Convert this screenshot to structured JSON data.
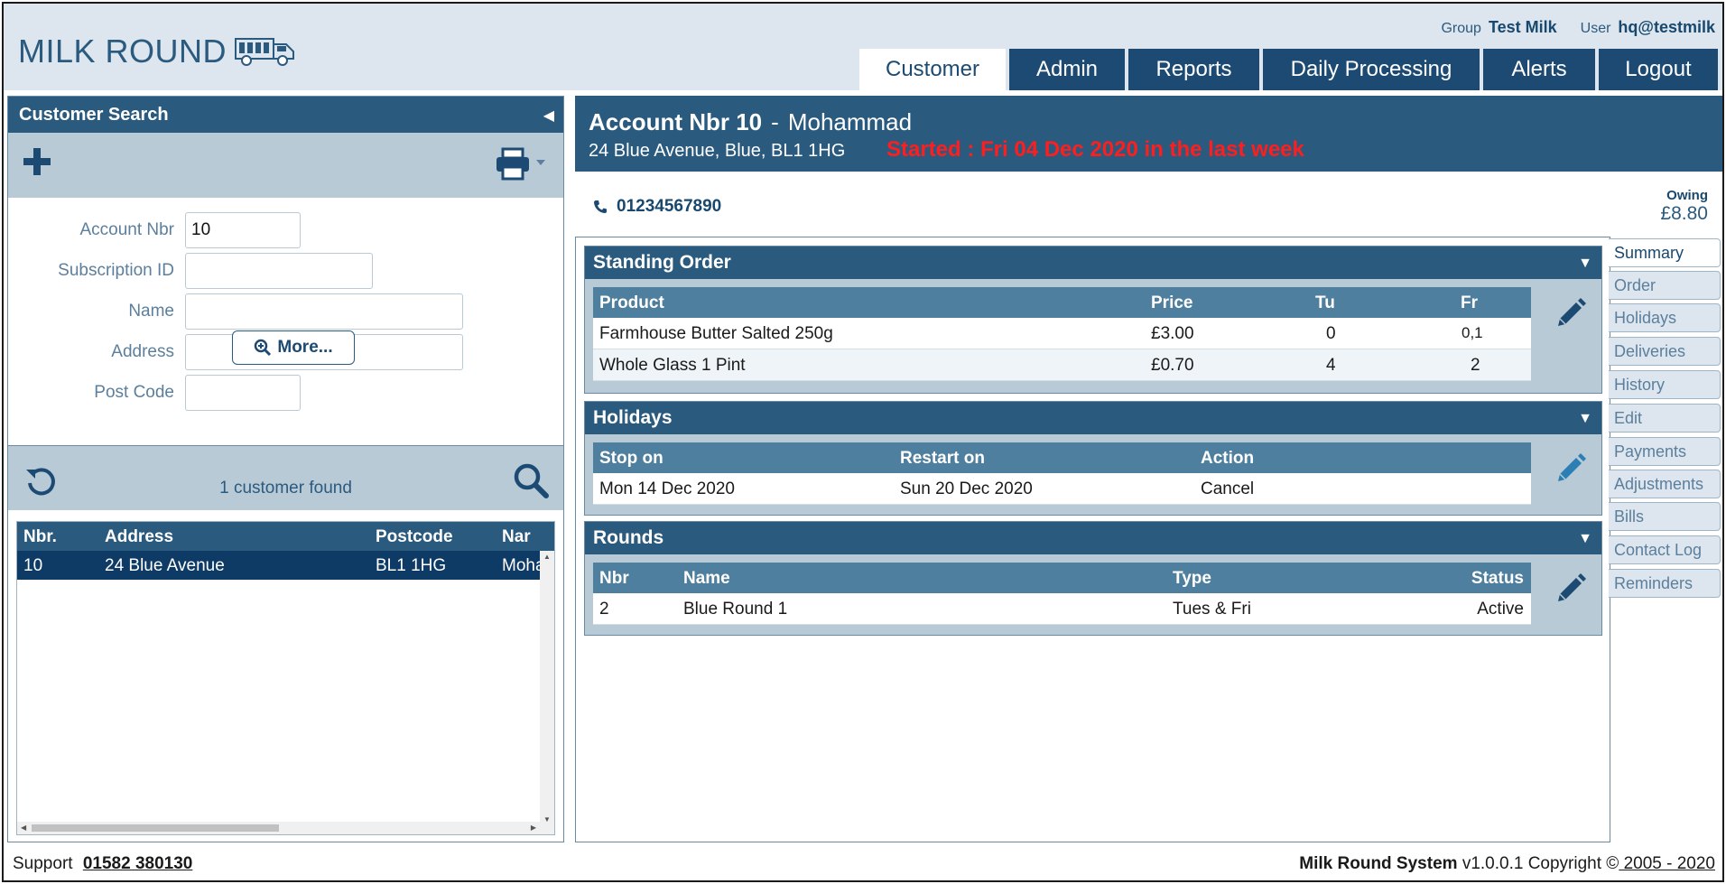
{
  "brand": {
    "name": "MILK ROUND"
  },
  "user_info": {
    "group_label": "Group",
    "group": "Test Milk",
    "user_label": "User",
    "user": "hq@testmilk"
  },
  "tabs": [
    {
      "label": "Customer"
    },
    {
      "label": "Admin"
    },
    {
      "label": "Reports"
    },
    {
      "label": "Daily Processing"
    },
    {
      "label": "Alerts"
    },
    {
      "label": "Logout"
    }
  ],
  "customer_search": {
    "title": "Customer Search",
    "collapse_glyph": "◀",
    "fields": [
      {
        "label": "Account Nbr",
        "value": "10"
      },
      {
        "label": "Subscription ID",
        "value": ""
      },
      {
        "label": "Name",
        "value": ""
      },
      {
        "label": "Address",
        "value": ""
      },
      {
        "label": "Post Code",
        "value": ""
      }
    ],
    "more_label": "More...",
    "found_text": "1 customer found",
    "grid": {
      "headers": [
        "Nbr.",
        "Address",
        "Postcode",
        "Nar"
      ],
      "rows": [
        [
          "10",
          "24 Blue Avenue",
          "BL1 1HG",
          "Moha"
        ]
      ]
    }
  },
  "account": {
    "title": "Account Nbr 10",
    "separator": "-",
    "name": "Mohammad",
    "address": "24 Blue Avenue, Blue, BL1 1HG",
    "started": "Started : Fri 04 Dec 2020 in the last week",
    "phone": "01234567890",
    "owing_label": "Owing",
    "owing_value": "£8.80"
  },
  "standing_order": {
    "title": "Standing Order",
    "headers": [
      "Product",
      "Price",
      "Tu",
      "Fr"
    ],
    "rows": [
      [
        "Farmhouse Butter Salted 250g",
        "£3.00",
        "0",
        "0,1"
      ],
      [
        "Whole Glass 1 Pint",
        "£0.70",
        "4",
        "2"
      ]
    ]
  },
  "holidays": {
    "title": "Holidays",
    "headers": [
      "Stop on",
      "Restart on",
      "Action"
    ],
    "rows": [
      [
        "Mon 14 Dec 2020",
        "Sun 20 Dec 2020",
        "Cancel"
      ]
    ]
  },
  "rounds": {
    "title": "Rounds",
    "headers": [
      "Nbr",
      "Name",
      "Type",
      "Status"
    ],
    "rows": [
      [
        "2",
        "Blue Round 1",
        "Tues & Fri",
        "Active"
      ]
    ]
  },
  "side_tabs": [
    "Summary",
    "Order",
    "Holidays",
    "Deliveries",
    "History",
    "Edit",
    "Payments",
    "Adjustments",
    "Bills",
    "Contact Log",
    "Reminders"
  ],
  "footer": {
    "support_label": "Support",
    "support_phone": "01582 380130",
    "system_name": "Milk Round System",
    "version_text": "v1.0.0.1 Copyright ©",
    "years": " 2005 - 2020"
  },
  "colors": {
    "primary": "#2b5a7f",
    "dark": "#1d4a73",
    "panel": "#b9cad7",
    "header_bg": "#dde6ee",
    "alert": "#ff1e1e"
  },
  "icons": [
    "van-icon",
    "plus-icon",
    "printer-icon",
    "zoom-in-icon",
    "undo-icon",
    "search-icon",
    "phone-icon",
    "pencil-icon",
    "collapse-triangle-icon"
  ]
}
